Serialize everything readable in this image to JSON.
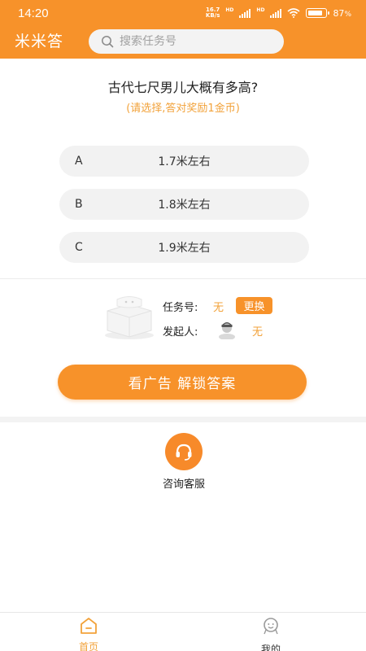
{
  "status_bar": {
    "time": "14:20",
    "net_speed_value": "16.7",
    "net_speed_unit": "KB/s",
    "hd1": "HD",
    "hd2": "HD",
    "battery_percent": "87",
    "battery_suffix": "%",
    "battery_level": 0.87
  },
  "header": {
    "title": "米米答",
    "search_placeholder": "搜索任务号"
  },
  "question": {
    "text": "古代七尺男儿大概有多高?",
    "hint": "(请选择,答对奖励1金币)",
    "options": [
      {
        "letter": "A",
        "text": "1.7米左右"
      },
      {
        "letter": "B",
        "text": "1.8米左右"
      },
      {
        "letter": "C",
        "text": "1.9米左右"
      }
    ]
  },
  "task": {
    "number_label": "任务号:",
    "number_value": "无",
    "swap_label": "更换",
    "initiator_label": "发起人:",
    "initiator_value": "无"
  },
  "unlock_button": "看广告 解锁答案",
  "support": {
    "label": "咨询客服"
  },
  "tabs": [
    {
      "label": "首页",
      "icon": "home-icon",
      "active": true
    },
    {
      "label": "我的",
      "icon": "profile-icon",
      "active": false
    }
  ],
  "colors": {
    "brand": "#f7922a",
    "accent_text": "#f2a23a"
  }
}
